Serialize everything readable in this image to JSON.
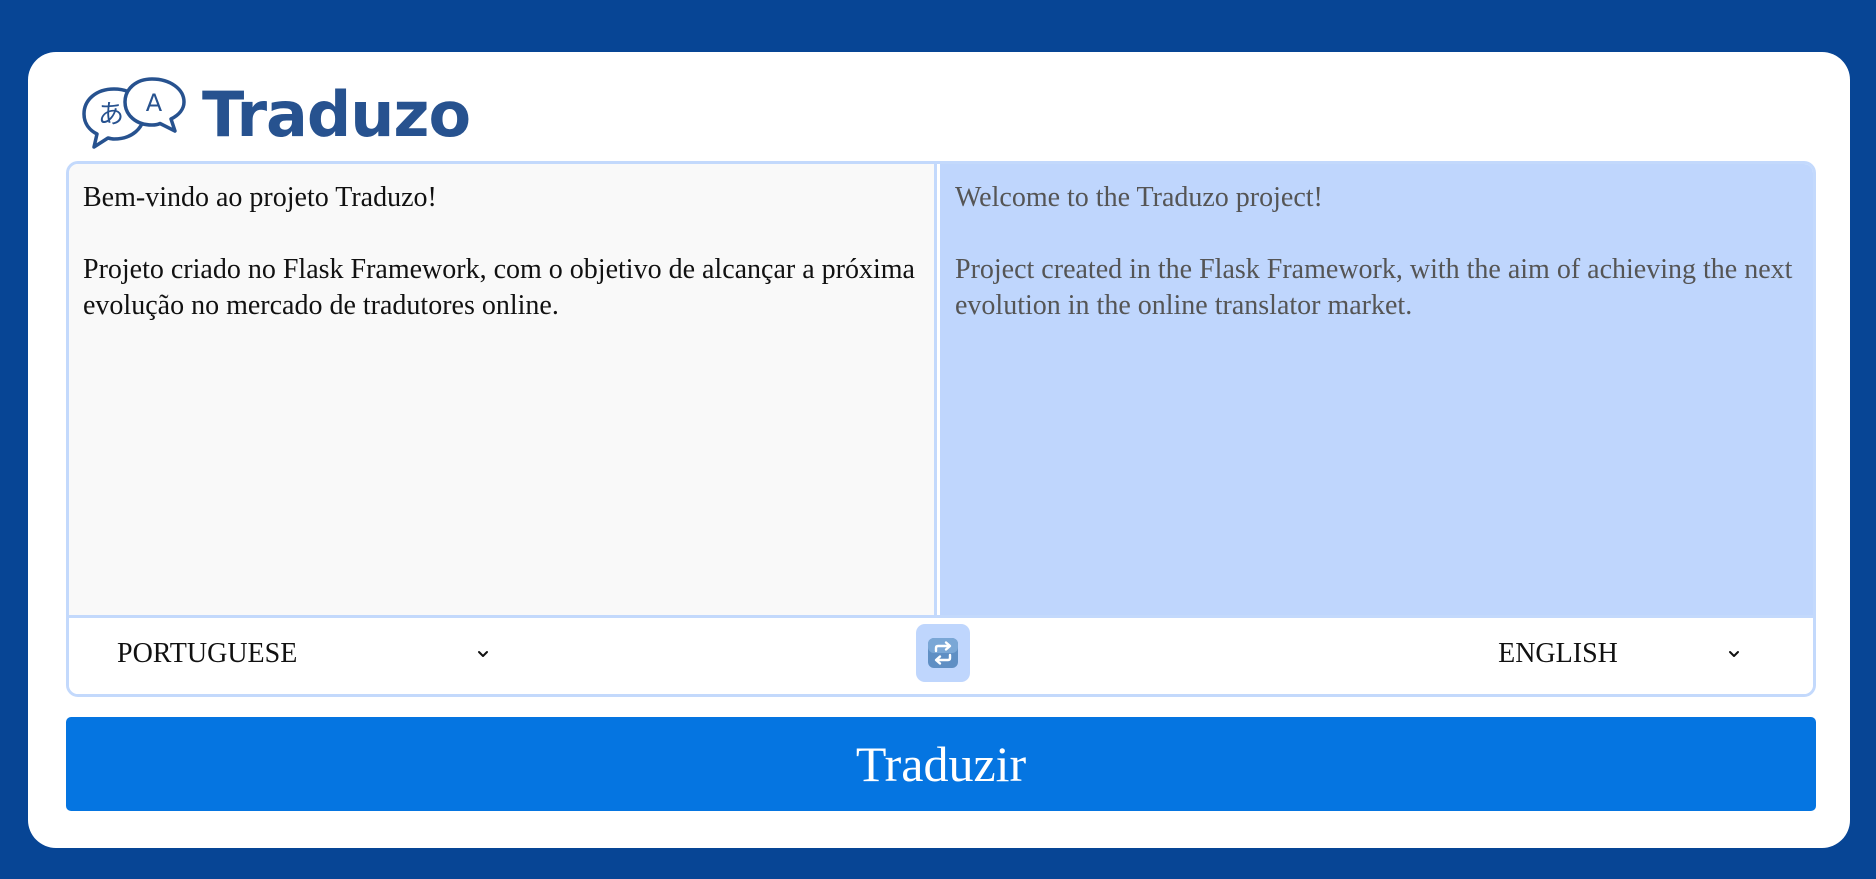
{
  "app": {
    "name": "Traduzo"
  },
  "source": {
    "text": "Bem-vindo ao projeto Traduzo!\n\nProjeto criado no Flask Framework, com o objetivo de alcançar a próxima evolução no mercado de tradutores online.",
    "language": "PORTUGUESE"
  },
  "target": {
    "text": "Welcome to the Traduzo project!\n\nProject created in the Flask Framework, with the aim of achieving the next evolution in the online translator market.",
    "language": "ENGLISH"
  },
  "actions": {
    "translate_label": "Traduzir",
    "swap_icon": "swap-arrows-icon"
  },
  "colors": {
    "page_background": "#074595",
    "brand": "#27528f",
    "button": "#0575e1",
    "target_background": "#bfd6fd",
    "border": "#c3d9fc"
  }
}
